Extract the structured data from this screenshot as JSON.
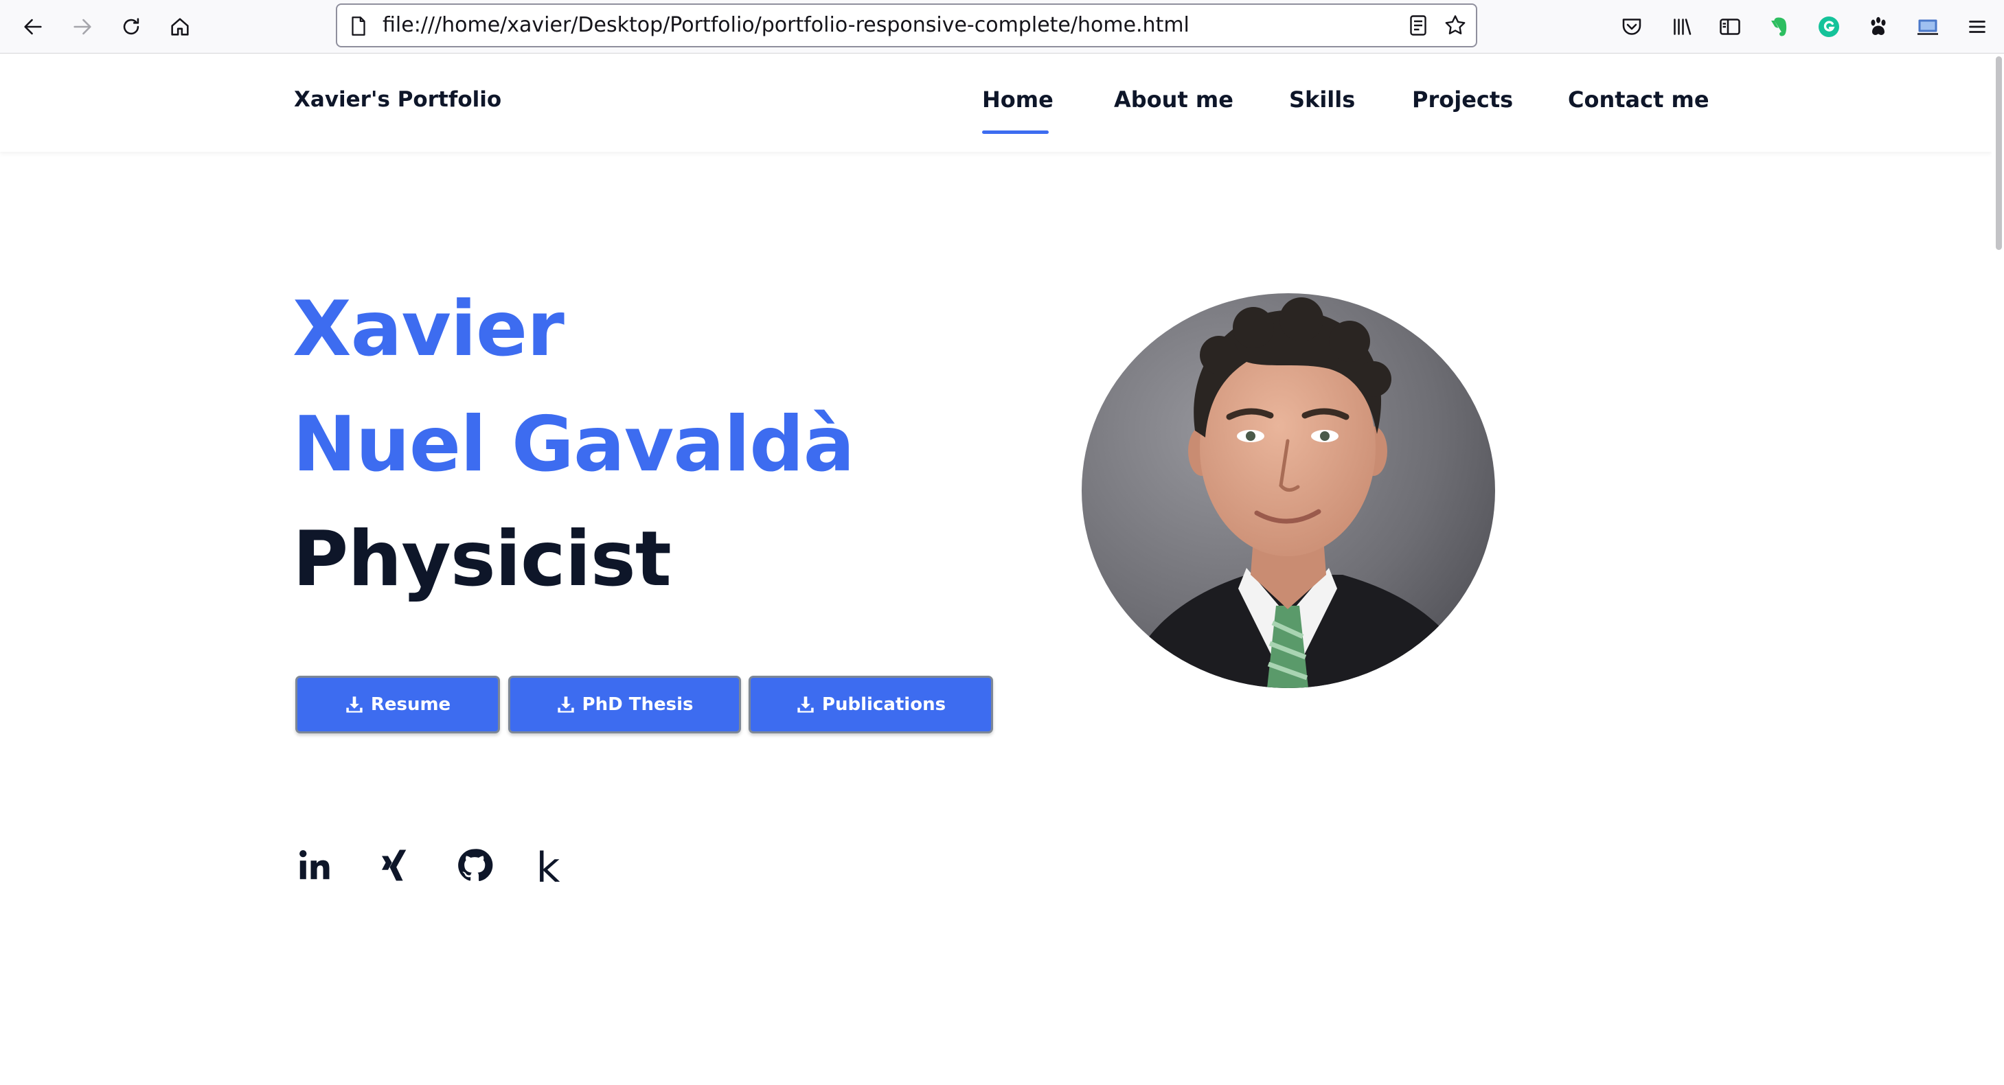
{
  "browser": {
    "url": "file:///home/xavier/Desktop/Portfolio/portfolio-responsive-complete/home.html",
    "toolbar_icons": [
      "back-icon",
      "forward-icon",
      "reload-icon",
      "home-icon"
    ],
    "url_icons": [
      "page-icon",
      "reader-view-icon",
      "bookmark-star-icon"
    ],
    "extension_icons": [
      "pocket-icon",
      "library-icon",
      "sidebar-icon",
      "evernote-icon",
      "grammarly-icon",
      "paw-icon",
      "screen-icon",
      "menu-icon"
    ]
  },
  "site": {
    "logo": "Xavier's Portfolio",
    "nav": [
      {
        "label": "Home",
        "active": true
      },
      {
        "label": "About me",
        "active": false
      },
      {
        "label": "Skills",
        "active": false
      },
      {
        "label": "Projects",
        "active": false
      },
      {
        "label": "Contact me",
        "active": false
      }
    ]
  },
  "hero": {
    "first_name": "Xavier",
    "last_name": "Nuel Gavaldà",
    "profession": "Physicist",
    "buttons": [
      {
        "label": "Resume",
        "icon": "download-icon"
      },
      {
        "label": "PhD Thesis",
        "icon": "download-icon"
      },
      {
        "label": "Publications",
        "icon": "download-icon"
      }
    ],
    "social": [
      {
        "name": "linkedin-icon",
        "glyph": "in"
      },
      {
        "name": "xing-icon",
        "glyph": ""
      },
      {
        "name": "github-icon",
        "glyph": ""
      },
      {
        "name": "kaggle-icon",
        "glyph": "k"
      }
    ],
    "photo_alt": "profile-photo"
  },
  "colors": {
    "accent": "#3d6cf0",
    "dark": "#0e1629",
    "white": "#ffffff"
  }
}
